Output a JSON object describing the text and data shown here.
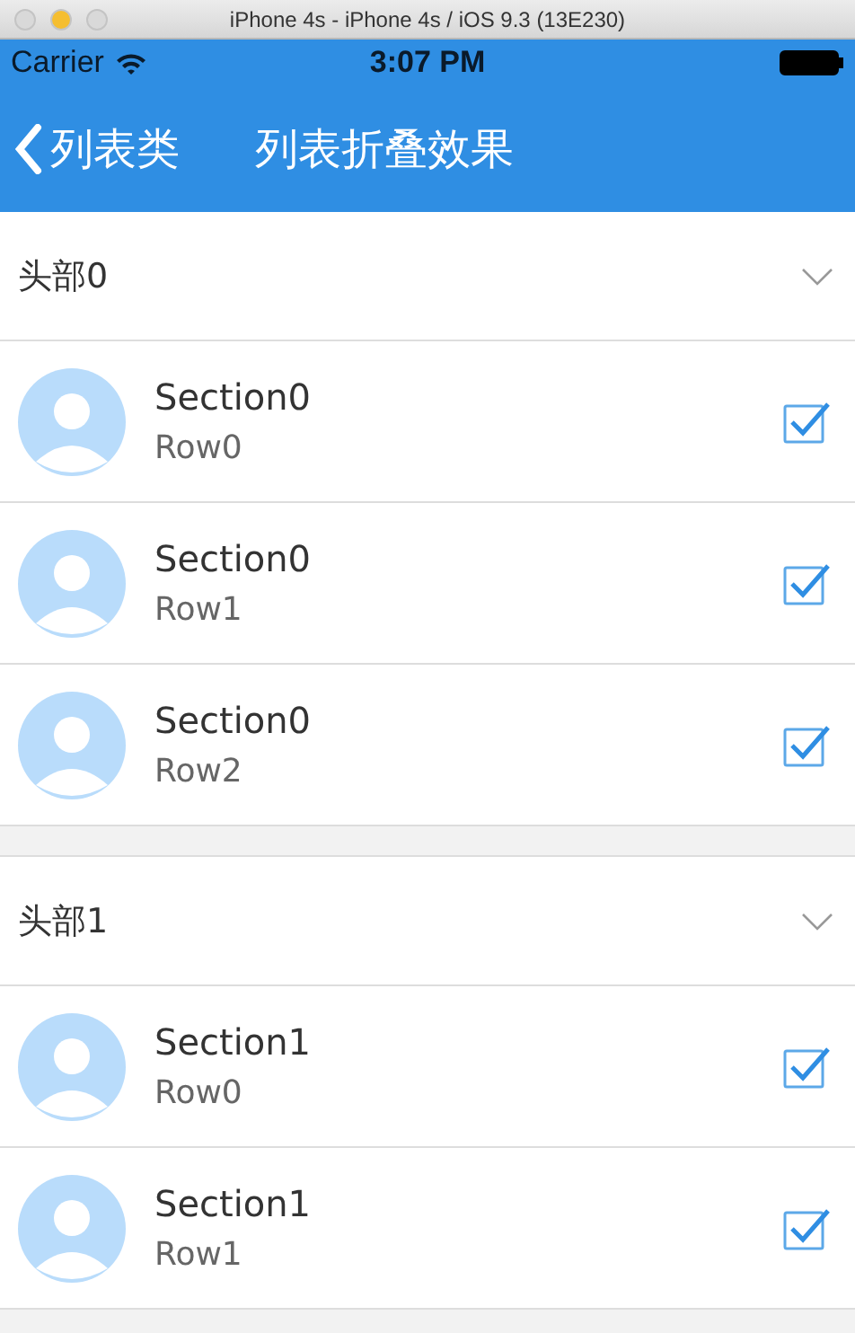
{
  "window": {
    "title": "iPhone 4s - iPhone 4s / iOS 9.3 (13E230)"
  },
  "status_bar": {
    "carrier": "Carrier",
    "time": "3:07 PM"
  },
  "nav_bar": {
    "back": "列表类",
    "title": "列表折叠效果"
  },
  "sections": [
    {
      "header": "头部0",
      "expanded": true,
      "rows": [
        {
          "title": "Section0",
          "subtitle": "Row0",
          "checked": true
        },
        {
          "title": "Section0",
          "subtitle": "Row1",
          "checked": true
        },
        {
          "title": "Section0",
          "subtitle": "Row2",
          "checked": true
        }
      ]
    },
    {
      "header": "头部1",
      "expanded": true,
      "rows": [
        {
          "title": "Section1",
          "subtitle": "Row0",
          "checked": true
        },
        {
          "title": "Section1",
          "subtitle": "Row1",
          "checked": true
        }
      ]
    }
  ]
}
